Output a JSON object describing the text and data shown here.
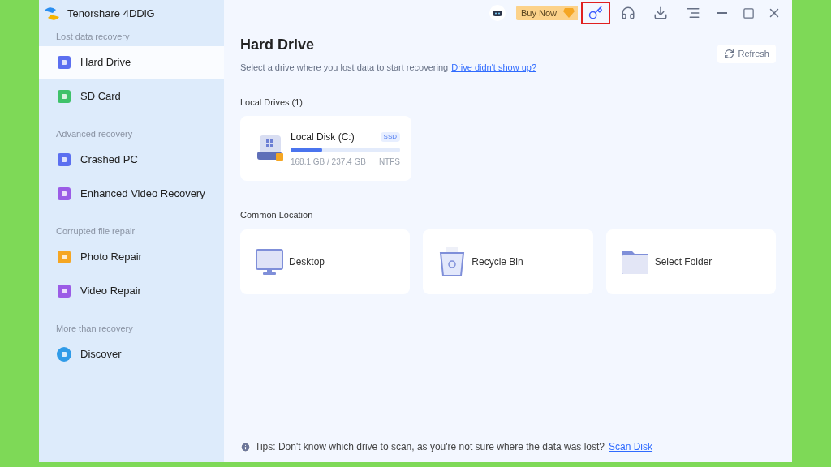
{
  "app": {
    "title": "Tenorshare 4DDiG"
  },
  "sidebar": {
    "sections": [
      {
        "heading": "Lost data recovery",
        "items": [
          {
            "label": "Hard Drive",
            "selected": true
          },
          {
            "label": "SD Card",
            "selected": false
          }
        ]
      },
      {
        "heading": "Advanced recovery",
        "items": [
          {
            "label": "Crashed PC",
            "selected": false
          },
          {
            "label": "Enhanced Video Recovery",
            "selected": false
          }
        ]
      },
      {
        "heading": "Corrupted file repair",
        "items": [
          {
            "label": "Photo Repair",
            "selected": false
          },
          {
            "label": "Video Repair",
            "selected": false
          }
        ]
      },
      {
        "heading": "More than recovery",
        "items": [
          {
            "label": "Discover",
            "selected": false
          }
        ]
      }
    ]
  },
  "toolbar": {
    "buy_button": "Buy Now",
    "buttons": [
      {
        "kind": "key",
        "highlighted": true
      },
      {
        "kind": "support",
        "highlighted": false
      },
      {
        "kind": "download",
        "highlighted": false
      },
      {
        "kind": "menu",
        "highlighted": false
      }
    ]
  },
  "page": {
    "title": "Hard Drive",
    "subtitle": "Select a drive where you lost data to start recovering",
    "subtitle_link": "Drive didn't show up?",
    "refresh_button": "Refresh"
  },
  "local_drives": {
    "heading": "Local Drives (1)",
    "drives": [
      {
        "name": "Local Disk (C:)",
        "badge": "SSD",
        "level": 0.29,
        "usage": "168.1 GB / 237.4 GB",
        "filesystem": "NTFS"
      }
    ]
  },
  "common_location": {
    "heading": "Common Location",
    "items": [
      {
        "label": "Desktop"
      },
      {
        "label": "Recycle Bin"
      },
      {
        "label": "Select Folder"
      }
    ]
  },
  "tips": {
    "text": "Tips: Don't know which drive to scan, as you're not sure where the data was lost?",
    "link": "Scan Disk"
  }
}
